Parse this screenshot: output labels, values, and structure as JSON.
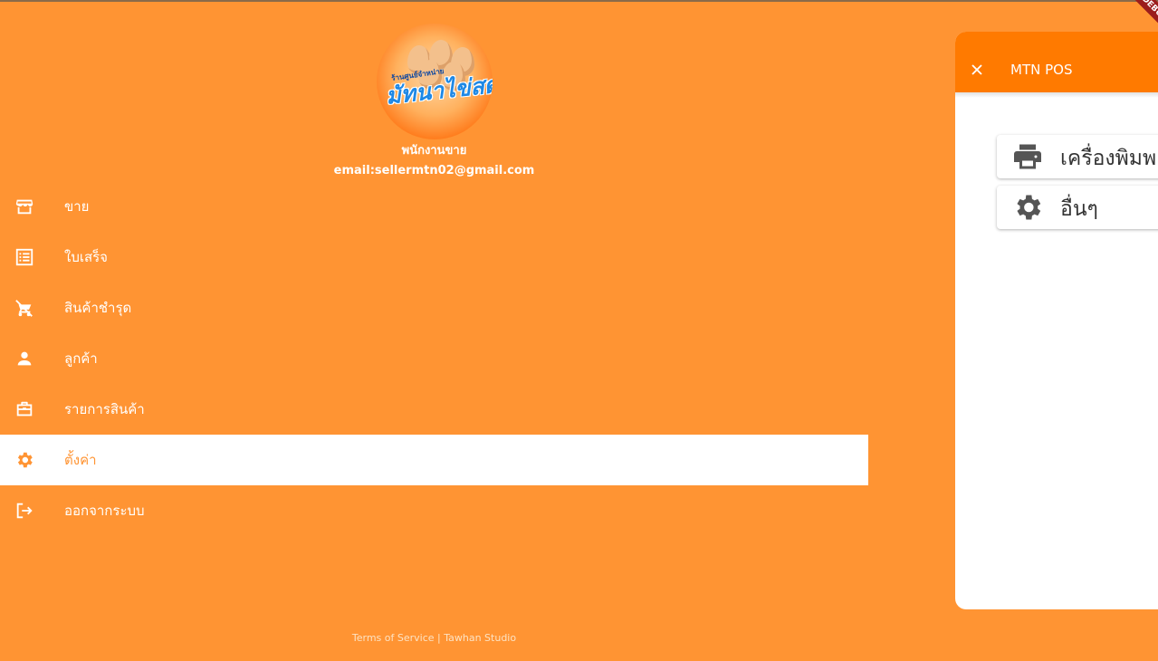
{
  "profile": {
    "logo_text": "มัทนาไข่สด",
    "logo_subtitle": "ร้านศูนย์จำหน่าย",
    "role": "พนักงานขาย",
    "email": "email:sellermtn02@gmail.com"
  },
  "menu": {
    "items": [
      {
        "label": "ขาย",
        "icon": "store-icon"
      },
      {
        "label": "ใบเสร็จ",
        "icon": "receipt-list-icon"
      },
      {
        "label": "สินค้าชำรุด",
        "icon": "cart-off-icon"
      },
      {
        "label": "ลูกค้า",
        "icon": "person-icon"
      },
      {
        "label": "รายการสินค้า",
        "icon": "briefcase-icon"
      },
      {
        "label": "ตั้งค่า",
        "icon": "gear-icon",
        "active": true
      },
      {
        "label": "ออกจากระบบ",
        "icon": "logout-icon"
      }
    ]
  },
  "footer": {
    "text": "Terms of Service | Tawhan Studio"
  },
  "panel": {
    "title": "MTN POS",
    "items": [
      {
        "label": "เครื่องพิมพ",
        "icon": "printer-icon"
      },
      {
        "label": "อื่นๆ",
        "icon": "gear-icon"
      }
    ]
  },
  "debug_banner": {
    "label": "DEBUG"
  },
  "colors": {
    "background": "#FF9433",
    "header": "#FF7A00",
    "active_bg": "#FFFFFF",
    "banner": "#9B1C1C"
  }
}
